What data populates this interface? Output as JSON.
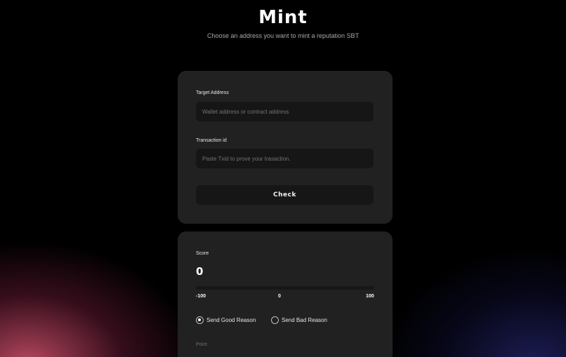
{
  "header": {
    "title": "Mint",
    "subtitle": "Choose an address you want to mint a reputation SBT"
  },
  "form": {
    "target_label": "Target Address",
    "target_placeholder": "Wallet address or contract address",
    "target_value": "",
    "txid_label": "Transaction id",
    "txid_placeholder": "Paste Txid to prove your trasaction.",
    "txid_value": "",
    "check_label": "Check"
  },
  "score": {
    "label": "Score",
    "value": "0",
    "slider": {
      "min": -100,
      "max": 100,
      "current": 0
    },
    "tick_min": "-100",
    "tick_mid": "0",
    "tick_max": "100"
  },
  "reason": {
    "options": [
      {
        "label": "Send Good Reason",
        "selected": true
      },
      {
        "label": "Send Bad Reason",
        "selected": false
      }
    ],
    "point_label": "Point"
  },
  "colors": {
    "background": "#000000",
    "card": "#212121",
    "input": "#161616",
    "accent_glow_left": "#d65470",
    "accent_glow_right": "#28287a"
  }
}
